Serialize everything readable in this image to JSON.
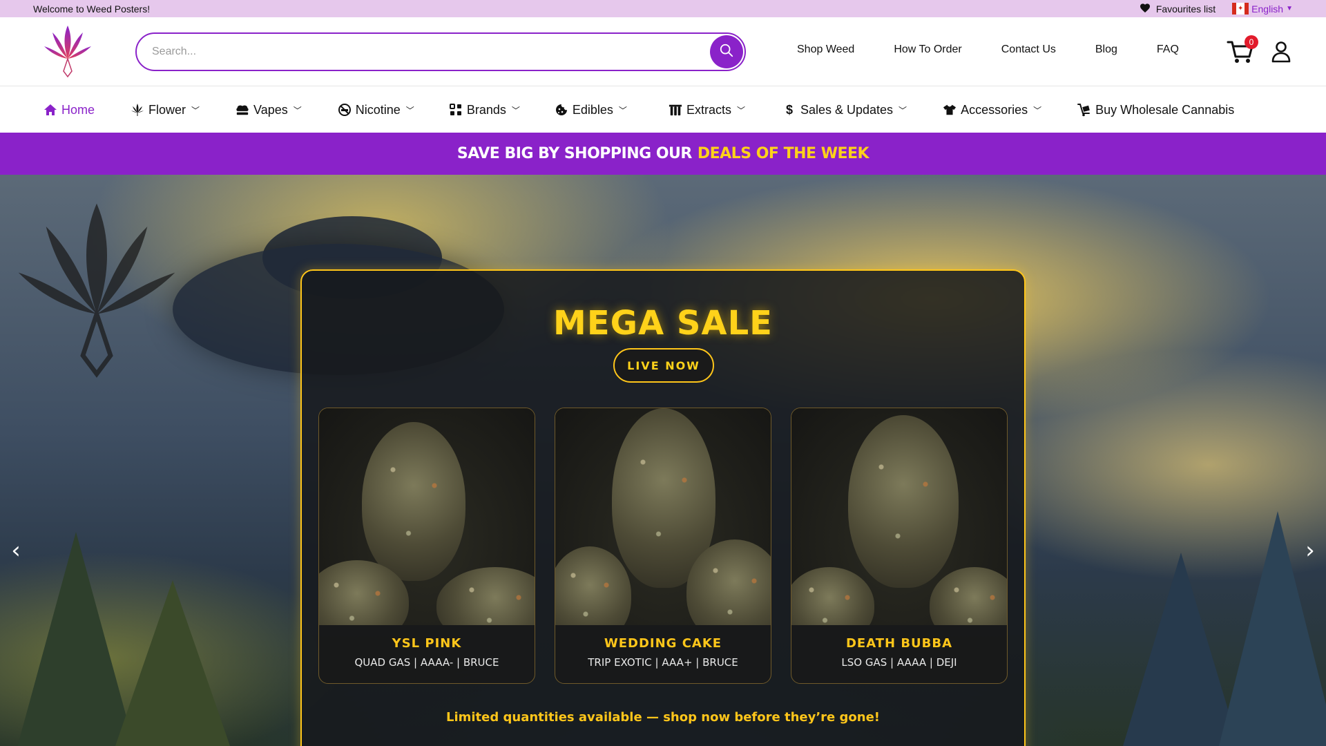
{
  "topbar": {
    "welcome": "Welcome to Weed Posters!",
    "favourites": "Favourites list",
    "language": "English"
  },
  "header": {
    "search_placeholder": "Search...",
    "nav": [
      "Shop Weed",
      "How To Order",
      "Contact Us",
      "Blog",
      "FAQ"
    ],
    "cart_count": "0"
  },
  "categories": [
    {
      "label": "Home",
      "icon": "home-icon",
      "dropdown": false,
      "active": true
    },
    {
      "label": "Flower",
      "icon": "leaf-icon",
      "dropdown": true,
      "active": false
    },
    {
      "label": "Vapes",
      "icon": "vape-icon",
      "dropdown": true,
      "active": false
    },
    {
      "label": "Nicotine",
      "icon": "no-smoking-icon",
      "dropdown": true,
      "active": false
    },
    {
      "label": "Brands",
      "icon": "grid-icon",
      "dropdown": true,
      "active": false
    },
    {
      "label": "Edibles",
      "icon": "cookie-icon",
      "dropdown": true,
      "active": false
    },
    {
      "label": "Extracts",
      "icon": "flask-icon",
      "dropdown": true,
      "active": false
    },
    {
      "label": "Sales & Updates",
      "icon": "dollar-icon",
      "dropdown": true,
      "active": false
    },
    {
      "label": "Accessories",
      "icon": "shirt-icon",
      "dropdown": true,
      "active": false
    },
    {
      "label": "Buy Wholesale Cannabis",
      "icon": "cart-dolly-icon",
      "dropdown": false,
      "active": false
    }
  ],
  "promo": {
    "text": "Save big by shopping our",
    "highlight": "Deals of the week"
  },
  "hero": {
    "title": "MEGA SALE",
    "button": "LIVE NOW",
    "products": [
      {
        "name": "YSL PINK",
        "meta": "QUAD GAS | AAAA- | BRUCE"
      },
      {
        "name": "WEDDING CAKE",
        "meta": "TRIP EXOTIC | AAA+ | BRUCE"
      },
      {
        "name": "DEATH BUBBA",
        "meta": "LSO GAS | AAAA | DEJI"
      }
    ],
    "footer": "Limited quantities available — shop now before they’re gone!"
  },
  "colors": {
    "brand_purple": "#8a22c9",
    "accent_yellow": "#ffc61a",
    "topbar_bg": "#e6c8ec",
    "badge_red": "#e21b2b"
  }
}
